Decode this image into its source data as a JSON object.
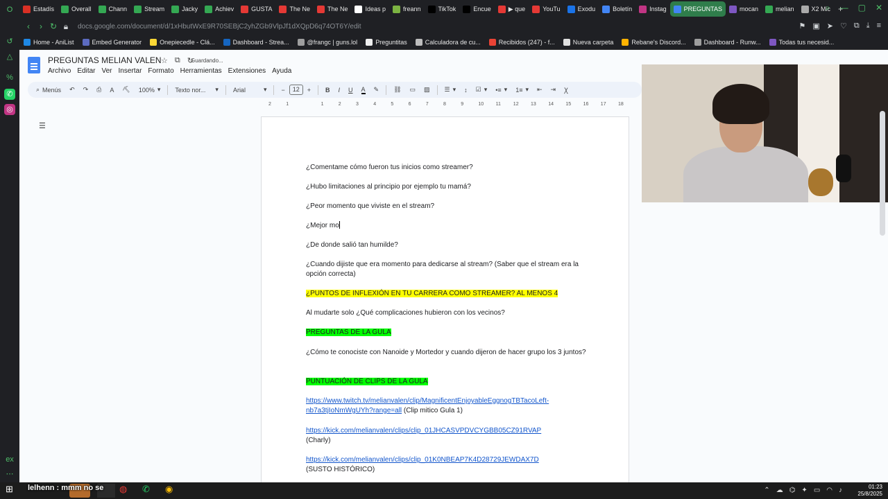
{
  "browser": {
    "tabs": [
      {
        "label": "Estadís",
        "color": "#d93025"
      },
      {
        "label": "Overall",
        "color": "#34a853"
      },
      {
        "label": "Chann",
        "color": "#34a853"
      },
      {
        "label": "Stream",
        "color": "#34a853"
      },
      {
        "label": "Jacky",
        "color": "#34a853"
      },
      {
        "label": "Achiev",
        "color": "#34a853"
      },
      {
        "label": "GUSTA",
        "color": "#e53935"
      },
      {
        "label": "The Ne",
        "color": "#e53935"
      },
      {
        "label": "The Ne",
        "color": "#e53935"
      },
      {
        "label": "Ideas p",
        "color": "#ffffff"
      },
      {
        "label": "freann",
        "color": "#7cb342"
      },
      {
        "label": "TikTok",
        "color": "#000000"
      },
      {
        "label": "Encue",
        "color": "#000000"
      },
      {
        "label": "▶ que",
        "color": "#e53935"
      },
      {
        "label": "YouTu",
        "color": "#e53935"
      },
      {
        "label": "Exodu",
        "color": "#1a73e8"
      },
      {
        "label": "Boletín",
        "color": "#4285f4"
      },
      {
        "label": "Instag",
        "color": "#c13584"
      },
      {
        "label": "PREGUNTAS",
        "color": "#4285f4",
        "active": true
      },
      {
        "label": "mocan",
        "color": "#7e57c2"
      },
      {
        "label": "melian",
        "color": "#34a853"
      },
      {
        "label": "X2 Mic",
        "color": "#aaaaaa"
      }
    ],
    "url": "docs.google.com/document/d/1xHbutWxE9R70SEBjC2yhZGb9VlpJf1dXQpD6q74OT6Y/edit",
    "bookmarks": [
      {
        "label": "Home - AniList",
        "color": "#1e88e5"
      },
      {
        "label": "Embed Generator",
        "color": "#5c6bc0"
      },
      {
        "label": "Onepiecedle - Clá...",
        "color": "#fdd835"
      },
      {
        "label": "Dashboard - Strea...",
        "color": "#1565c0"
      },
      {
        "label": "@frangc | guns.lol",
        "color": "#9e9e9e"
      },
      {
        "label": "Preguntitas",
        "color": "#eeeeee"
      },
      {
        "label": "Calculadora de cu...",
        "color": "#bdbdbd"
      },
      {
        "label": "Recibidos (247) - f...",
        "color": "#ea4335"
      },
      {
        "label": "Nueva carpeta",
        "color": "#e0e0e0"
      },
      {
        "label": "Rebane's Discord...",
        "color": "#ffb300"
      },
      {
        "label": "Dashboard - Runw...",
        "color": "#9e9e9e"
      },
      {
        "label": "Todas tus necesid...",
        "color": "#7e57c2"
      }
    ]
  },
  "docs": {
    "title": "PREGUNTAS MELIAN VALEN",
    "status": "Guardando...",
    "menus": [
      "Archivo",
      "Editar",
      "Ver",
      "Insertar",
      "Formato",
      "Herramientas",
      "Extensiones",
      "Ayuda"
    ],
    "toolbar": {
      "search_label": "Menús",
      "zoom": "100%",
      "style": "Texto nor...",
      "font": "Arial",
      "font_size": "12"
    },
    "ruler_ticks": [
      "2",
      "1",
      "",
      "1",
      "2",
      "3",
      "4",
      "5",
      "6",
      "7",
      "8",
      "9",
      "10",
      "11",
      "12",
      "13",
      "14",
      "15",
      "16",
      "17",
      "18"
    ],
    "paragraphs": [
      {
        "text": "¿Comentame cómo fueron tus inicios como streamer?"
      },
      {
        "text": "¿Hubo limitaciones al principio por ejemplo tu mamá?"
      },
      {
        "text": "¿Peor momento que viviste en el stream?"
      },
      {
        "text": "¿Mejor mo",
        "caret": true
      },
      {
        "text": "¿De donde salió tan humilde?"
      },
      {
        "text": "¿Cuando dijiste que era momento para dedicarse al stream? (Saber que el stream era la opción correcta)"
      },
      {
        "text": "¿PUNTOS DE INFLEXIÓN EN TU CARRERA COMO STREAMER? AL MENOS 4",
        "highlight": "yellow"
      },
      {
        "text": "Al mudarte solo ¿Qué complicaciones hubieron con los vecinos?"
      },
      {
        "text": "PREGUNTAS DE LA GULA",
        "highlight": "green"
      },
      {
        "text": "¿Cómo te conociste con Nanoide y Mortedor y cuando dijeron de hacer grupo los 3 juntos?"
      },
      {
        "text": "PUNTUACIÓN DE CLIPS DE LA GULA",
        "highlight": "green"
      },
      {
        "link": "https://www.twitch.tv/melianvalen/clip/MagnificentEnjoyableEggnogTBTacoLeft-nb7a3tjIoNmWgUYh?range=all",
        "text": " (Clip mitico Gula 1)"
      },
      {
        "link": "https://kick.com/melianvalen/clips/clip_01JHCASVPDVCYGBB05CZ91RVAP",
        "text": "(Charly)"
      },
      {
        "link": "https://kick.com/melianvalen/clips/clip_01K0NBEAP7K4D28729JEWDAX7D",
        "text": "(SUSTO HISTÓRICO)"
      }
    ]
  },
  "overlay": {
    "chat": "lelhenn : mmm no se"
  },
  "taskbar": {
    "time": "01:23",
    "date": "25/8/2025"
  }
}
